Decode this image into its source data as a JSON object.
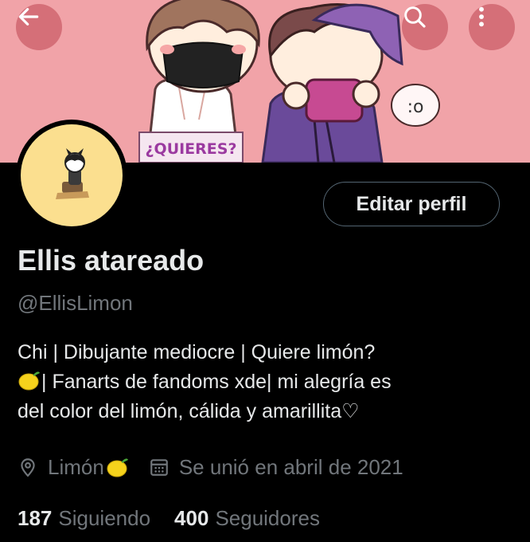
{
  "header": {
    "back_icon": "arrow-left-icon",
    "search_icon": "search-icon",
    "more_icon": "more-vertical-icon",
    "banner_sign": "¿QUIERES?",
    "banner_bubble": ":o",
    "colors": {
      "banner": "#f1a3a8",
      "nav_button": "#be4650"
    }
  },
  "profile": {
    "edit_button_label": "Editar perfil",
    "display_name": "Ellis atareado",
    "handle": "@EllisLimon",
    "bio": {
      "line1": "Chi | Dibujante mediocre | Quiere limón?",
      "line2": "| Fanarts de fandoms xde| mi alegría es",
      "line3": "del color del limón, cálida y amarillita♡",
      "emoji_icon": "lemon-emoji"
    },
    "location": "Limón",
    "location_icon": "location-pin-icon",
    "joined": "Se unió en abril de 2021",
    "joined_icon": "calendar-icon"
  },
  "stats": {
    "following_count": "187",
    "following_label": "Siguiendo",
    "followers_count": "400",
    "followers_label": "Seguidores"
  },
  "theme": {
    "background": "#000000",
    "text": "#e7e9ea",
    "secondary_text": "#71767b",
    "border": "#536471",
    "avatar_bg": "#fbdf8f"
  }
}
